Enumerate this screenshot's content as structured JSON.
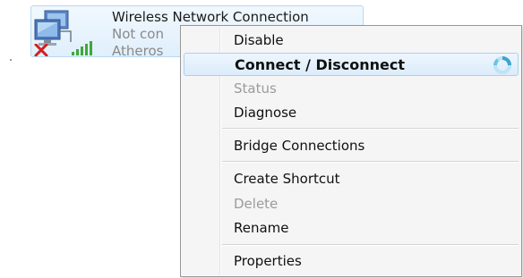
{
  "connection": {
    "name": "Wireless Network Connection",
    "status": "Not con",
    "adapter": "Atheros"
  },
  "icons": {
    "network": "network-adapter-icon",
    "disconnected": "red-x-icon",
    "signal": "signal-strength-icon",
    "busy": "busy-spinner-icon"
  },
  "menu": {
    "disable": "Disable",
    "connect_disconnect": "Connect / Disconnect",
    "status": "Status",
    "diagnose": "Diagnose",
    "bridge": "Bridge Connections",
    "create_shortcut": "Create Shortcut",
    "delete": "Delete",
    "rename": "Rename",
    "properties": "Properties"
  },
  "colors": {
    "highlight": "#dbecfb",
    "highlight_border": "#a9d0f3",
    "disabled_text": "#9b9b9b",
    "error": "#d21f1f",
    "signal": "#3fa83a"
  }
}
